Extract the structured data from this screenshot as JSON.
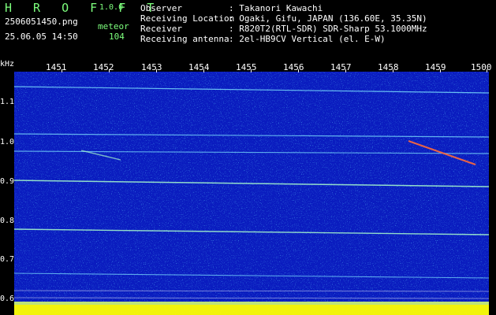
{
  "app": {
    "name": "H R O F F T",
    "version": "1.0.0"
  },
  "file": {
    "name": "2506051450.png",
    "datetime": "25.06.05 14:50",
    "label": "meteor",
    "count": "104"
  },
  "info": [
    {
      "label": "Observer",
      "value": ": Takanori Kawachi"
    },
    {
      "label": "Receiving Location",
      "value": ": Ogaki, Gifu, JAPAN (136.60E, 35.35N)"
    },
    {
      "label": "Receiver",
      "value": ": R820T2(RTL-SDR) SDR-Sharp 53.1000MHz"
    },
    {
      "label": "Receiving antenna",
      "value": ": 2el-HB9CV Vertical (el. E-W)"
    }
  ],
  "axis": {
    "unit": "kHz",
    "x_ticks": [
      "1451",
      "1452",
      "1453",
      "1454",
      "1455",
      "1456",
      "1457",
      "1458",
      "1459",
      "1500"
    ],
    "y_ticks": [
      "1.1",
      "1.0",
      "0.9",
      "0.8",
      "0.7",
      "0.6"
    ]
  },
  "colors": {
    "background": "#0a1cbf",
    "header_green": "#7dff7d",
    "signal": "#ffff00"
  }
}
